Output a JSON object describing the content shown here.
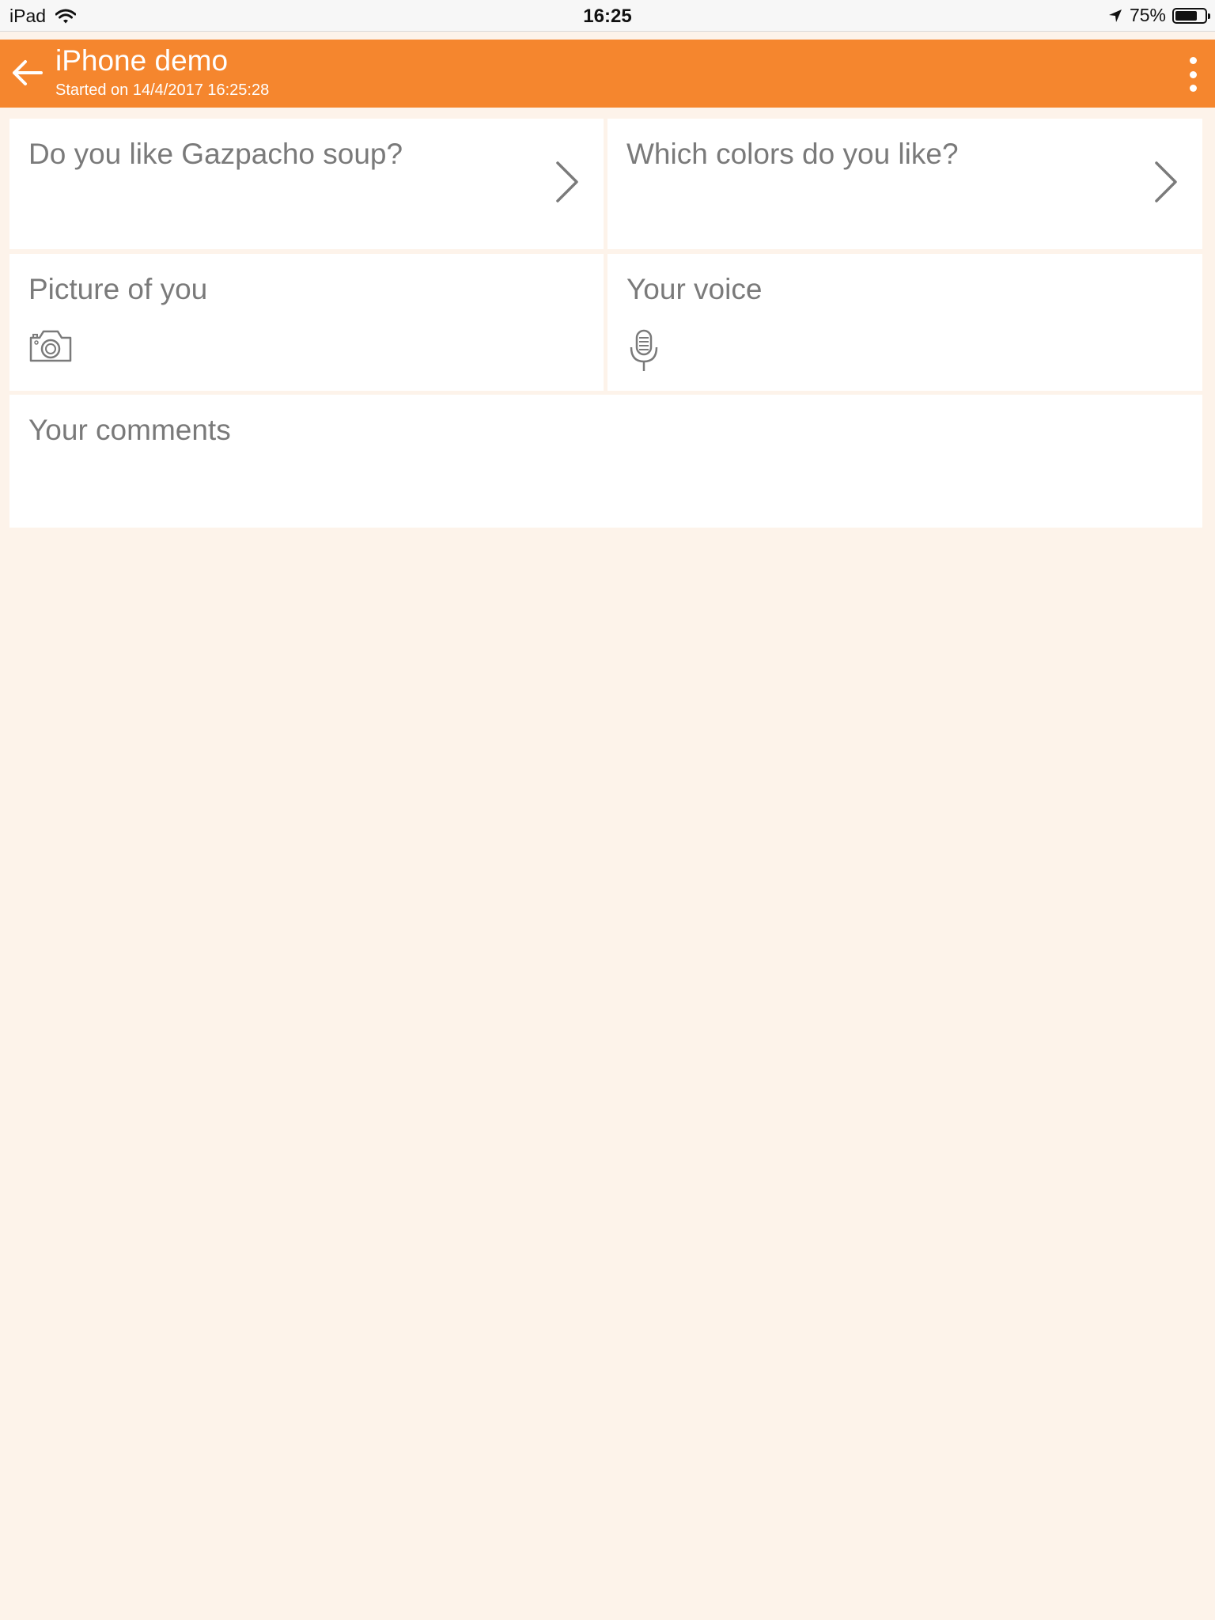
{
  "status_bar": {
    "device": "iPad",
    "time": "16:25",
    "battery_percent": "75%",
    "battery_level": 0.75,
    "icons": [
      "wifi-icon",
      "location-arrow-icon",
      "battery-icon"
    ]
  },
  "header": {
    "title": "iPhone demo",
    "subtitle": "Started on 14/4/2017 16:25:28",
    "back_icon": "arrow-left-icon",
    "menu_icon": "more-vertical-icon",
    "background_color": "#f5862e",
    "text_color": "#ffffff"
  },
  "questions": [
    {
      "label": "Do you like Gazpacho soup?",
      "icon": "chevron-right-icon"
    },
    {
      "label": "Which colors do you like?",
      "icon": "chevron-right-icon"
    },
    {
      "label": "Picture of you",
      "icon": "camera-icon"
    },
    {
      "label": "Your voice",
      "icon": "microphone-icon"
    },
    {
      "label": "Your comments"
    }
  ],
  "colors": {
    "accent": "#f5862e",
    "page_background": "#fdf3ea",
    "card_background": "#ffffff",
    "label_text": "#7a7a7a"
  }
}
